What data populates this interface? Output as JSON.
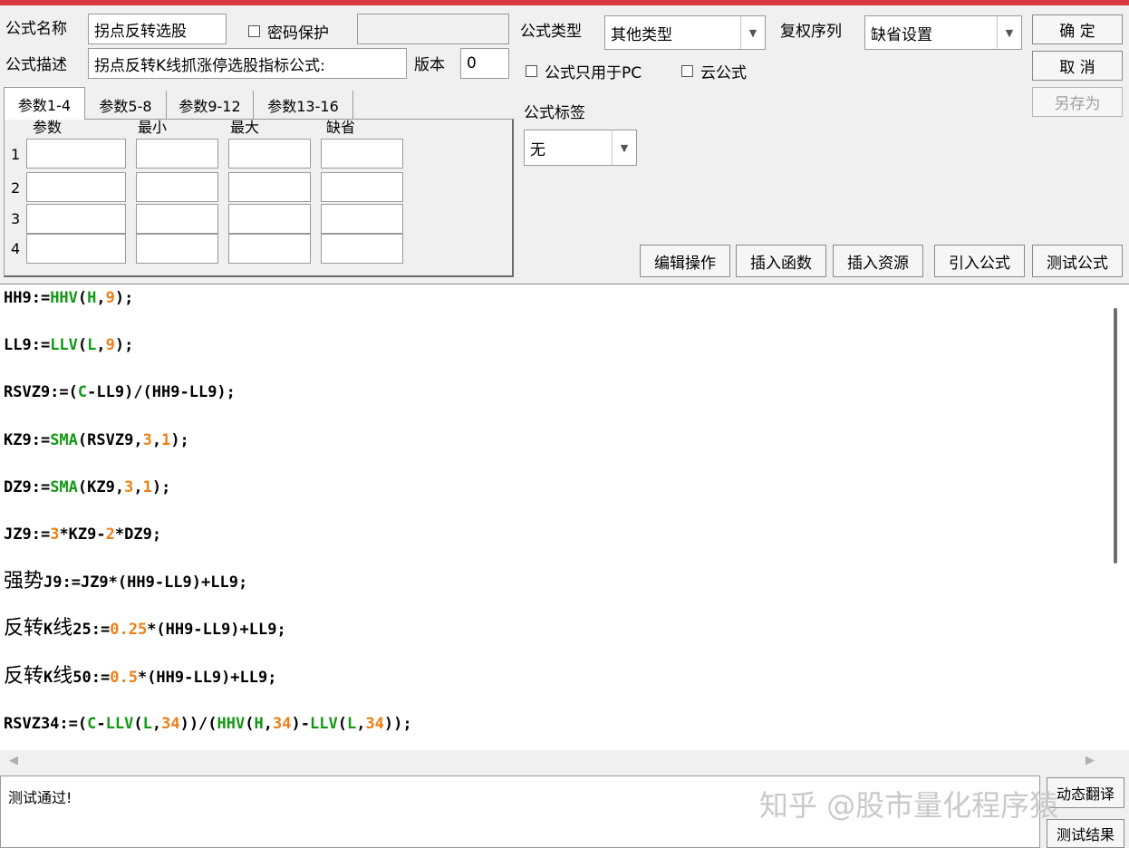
{
  "header": {
    "formula_name_label": "公式名称",
    "formula_name_value": "拐点反转选股",
    "password_label": "密码保护",
    "password_value": "",
    "formula_desc_label": "公式描述",
    "formula_desc_value": "拐点反转K线抓涨停选股指标公式:",
    "version_label": "版本",
    "version_value": "0",
    "formula_type_label": "公式类型",
    "formula_type_value": "其他类型",
    "rights_label": "复权序列",
    "rights_value": "缺省设置",
    "pc_only_label": "公式只用于PC",
    "cloud_label": "云公式",
    "tag_label": "公式标签",
    "tag_value": "无"
  },
  "buttons": {
    "ok": "确 定",
    "cancel": "取 消",
    "save_as": "另存为",
    "edit_op": "编辑操作",
    "insert_func": "插入函数",
    "insert_res": "插入资源",
    "import_formula": "引入公式",
    "test_formula": "测试公式",
    "translate": "动态翻译",
    "test_result": "测试结果"
  },
  "params": {
    "tabs": [
      "参数1-4",
      "参数5-8",
      "参数9-12",
      "参数13-16"
    ],
    "active_tab": 0,
    "columns": [
      "参数",
      "最小",
      "最大",
      "缺省"
    ],
    "rows": [
      "1",
      "2",
      "3",
      "4"
    ]
  },
  "code_lines": [
    [
      [
        "HH9:=",
        "p"
      ],
      [
        "HHV",
        "f"
      ],
      [
        "(",
        "p"
      ],
      [
        "H",
        "f"
      ],
      [
        ",",
        "p"
      ],
      [
        "9",
        "n"
      ],
      [
        ");",
        "p"
      ]
    ],
    [
      [
        "LL9:=",
        "p"
      ],
      [
        "LLV",
        "f"
      ],
      [
        "(",
        "p"
      ],
      [
        "L",
        "f"
      ],
      [
        ",",
        "p"
      ],
      [
        "9",
        "n"
      ],
      [
        ");",
        "p"
      ]
    ],
    [
      [
        "RSVZ9:=(",
        "p"
      ],
      [
        "C",
        "f"
      ],
      [
        "-LL9)/(HH9-LL9);",
        "p"
      ]
    ],
    [
      [
        "KZ9:=",
        "p"
      ],
      [
        "SMA",
        "f"
      ],
      [
        "(RSVZ9,",
        "p"
      ],
      [
        "3",
        "n"
      ],
      [
        ",",
        "p"
      ],
      [
        "1",
        "n"
      ],
      [
        ");",
        "p"
      ]
    ],
    [
      [
        "DZ9:=",
        "p"
      ],
      [
        "SMA",
        "f"
      ],
      [
        "(KZ9,",
        "p"
      ],
      [
        "3",
        "n"
      ],
      [
        ",",
        "p"
      ],
      [
        "1",
        "n"
      ],
      [
        ");",
        "p"
      ]
    ],
    [
      [
        "JZ9:=",
        "p"
      ],
      [
        "3",
        "n"
      ],
      [
        "*KZ9-",
        "p"
      ],
      [
        "2",
        "n"
      ],
      [
        "*DZ9;",
        "p"
      ]
    ],
    [
      [
        "强势",
        "c"
      ],
      [
        "J9:=JZ9*(HH9-LL9)+LL9;",
        "p"
      ]
    ],
    [
      [
        "反转",
        "c"
      ],
      [
        "K",
        "p"
      ],
      [
        "线",
        "c"
      ],
      [
        "25:=",
        "p"
      ],
      [
        "0.25",
        "n"
      ],
      [
        "*(HH9-LL9)+LL9;",
        "p"
      ]
    ],
    [
      [
        "反转",
        "c"
      ],
      [
        "K",
        "p"
      ],
      [
        "线",
        "c"
      ],
      [
        "50:=",
        "p"
      ],
      [
        "0.5",
        "n"
      ],
      [
        "*(HH9-LL9)+LL9;",
        "p"
      ]
    ],
    [
      [
        "RSVZ34:=(",
        "p"
      ],
      [
        "C",
        "f"
      ],
      [
        "-",
        "p"
      ],
      [
        "LLV",
        "f"
      ],
      [
        "(",
        "p"
      ],
      [
        "L",
        "f"
      ],
      [
        ",",
        "p"
      ],
      [
        "34",
        "n"
      ],
      [
        "))/(",
        "p"
      ],
      [
        "HHV",
        "f"
      ],
      [
        "(",
        "p"
      ],
      [
        "H",
        "f"
      ],
      [
        ",",
        "p"
      ],
      [
        "34",
        "n"
      ],
      [
        ")-",
        "p"
      ],
      [
        "LLV",
        "f"
      ],
      [
        "(",
        "p"
      ],
      [
        "L",
        "f"
      ],
      [
        ",",
        "p"
      ],
      [
        "34",
        "n"
      ],
      [
        "));",
        "p"
      ]
    ]
  ],
  "output": {
    "status": "测试通过!"
  },
  "watermark": "知乎 @股市量化程序猿",
  "colors": {
    "function": "#119911",
    "number": "#f07e14",
    "top_bar": "#d9393f"
  }
}
